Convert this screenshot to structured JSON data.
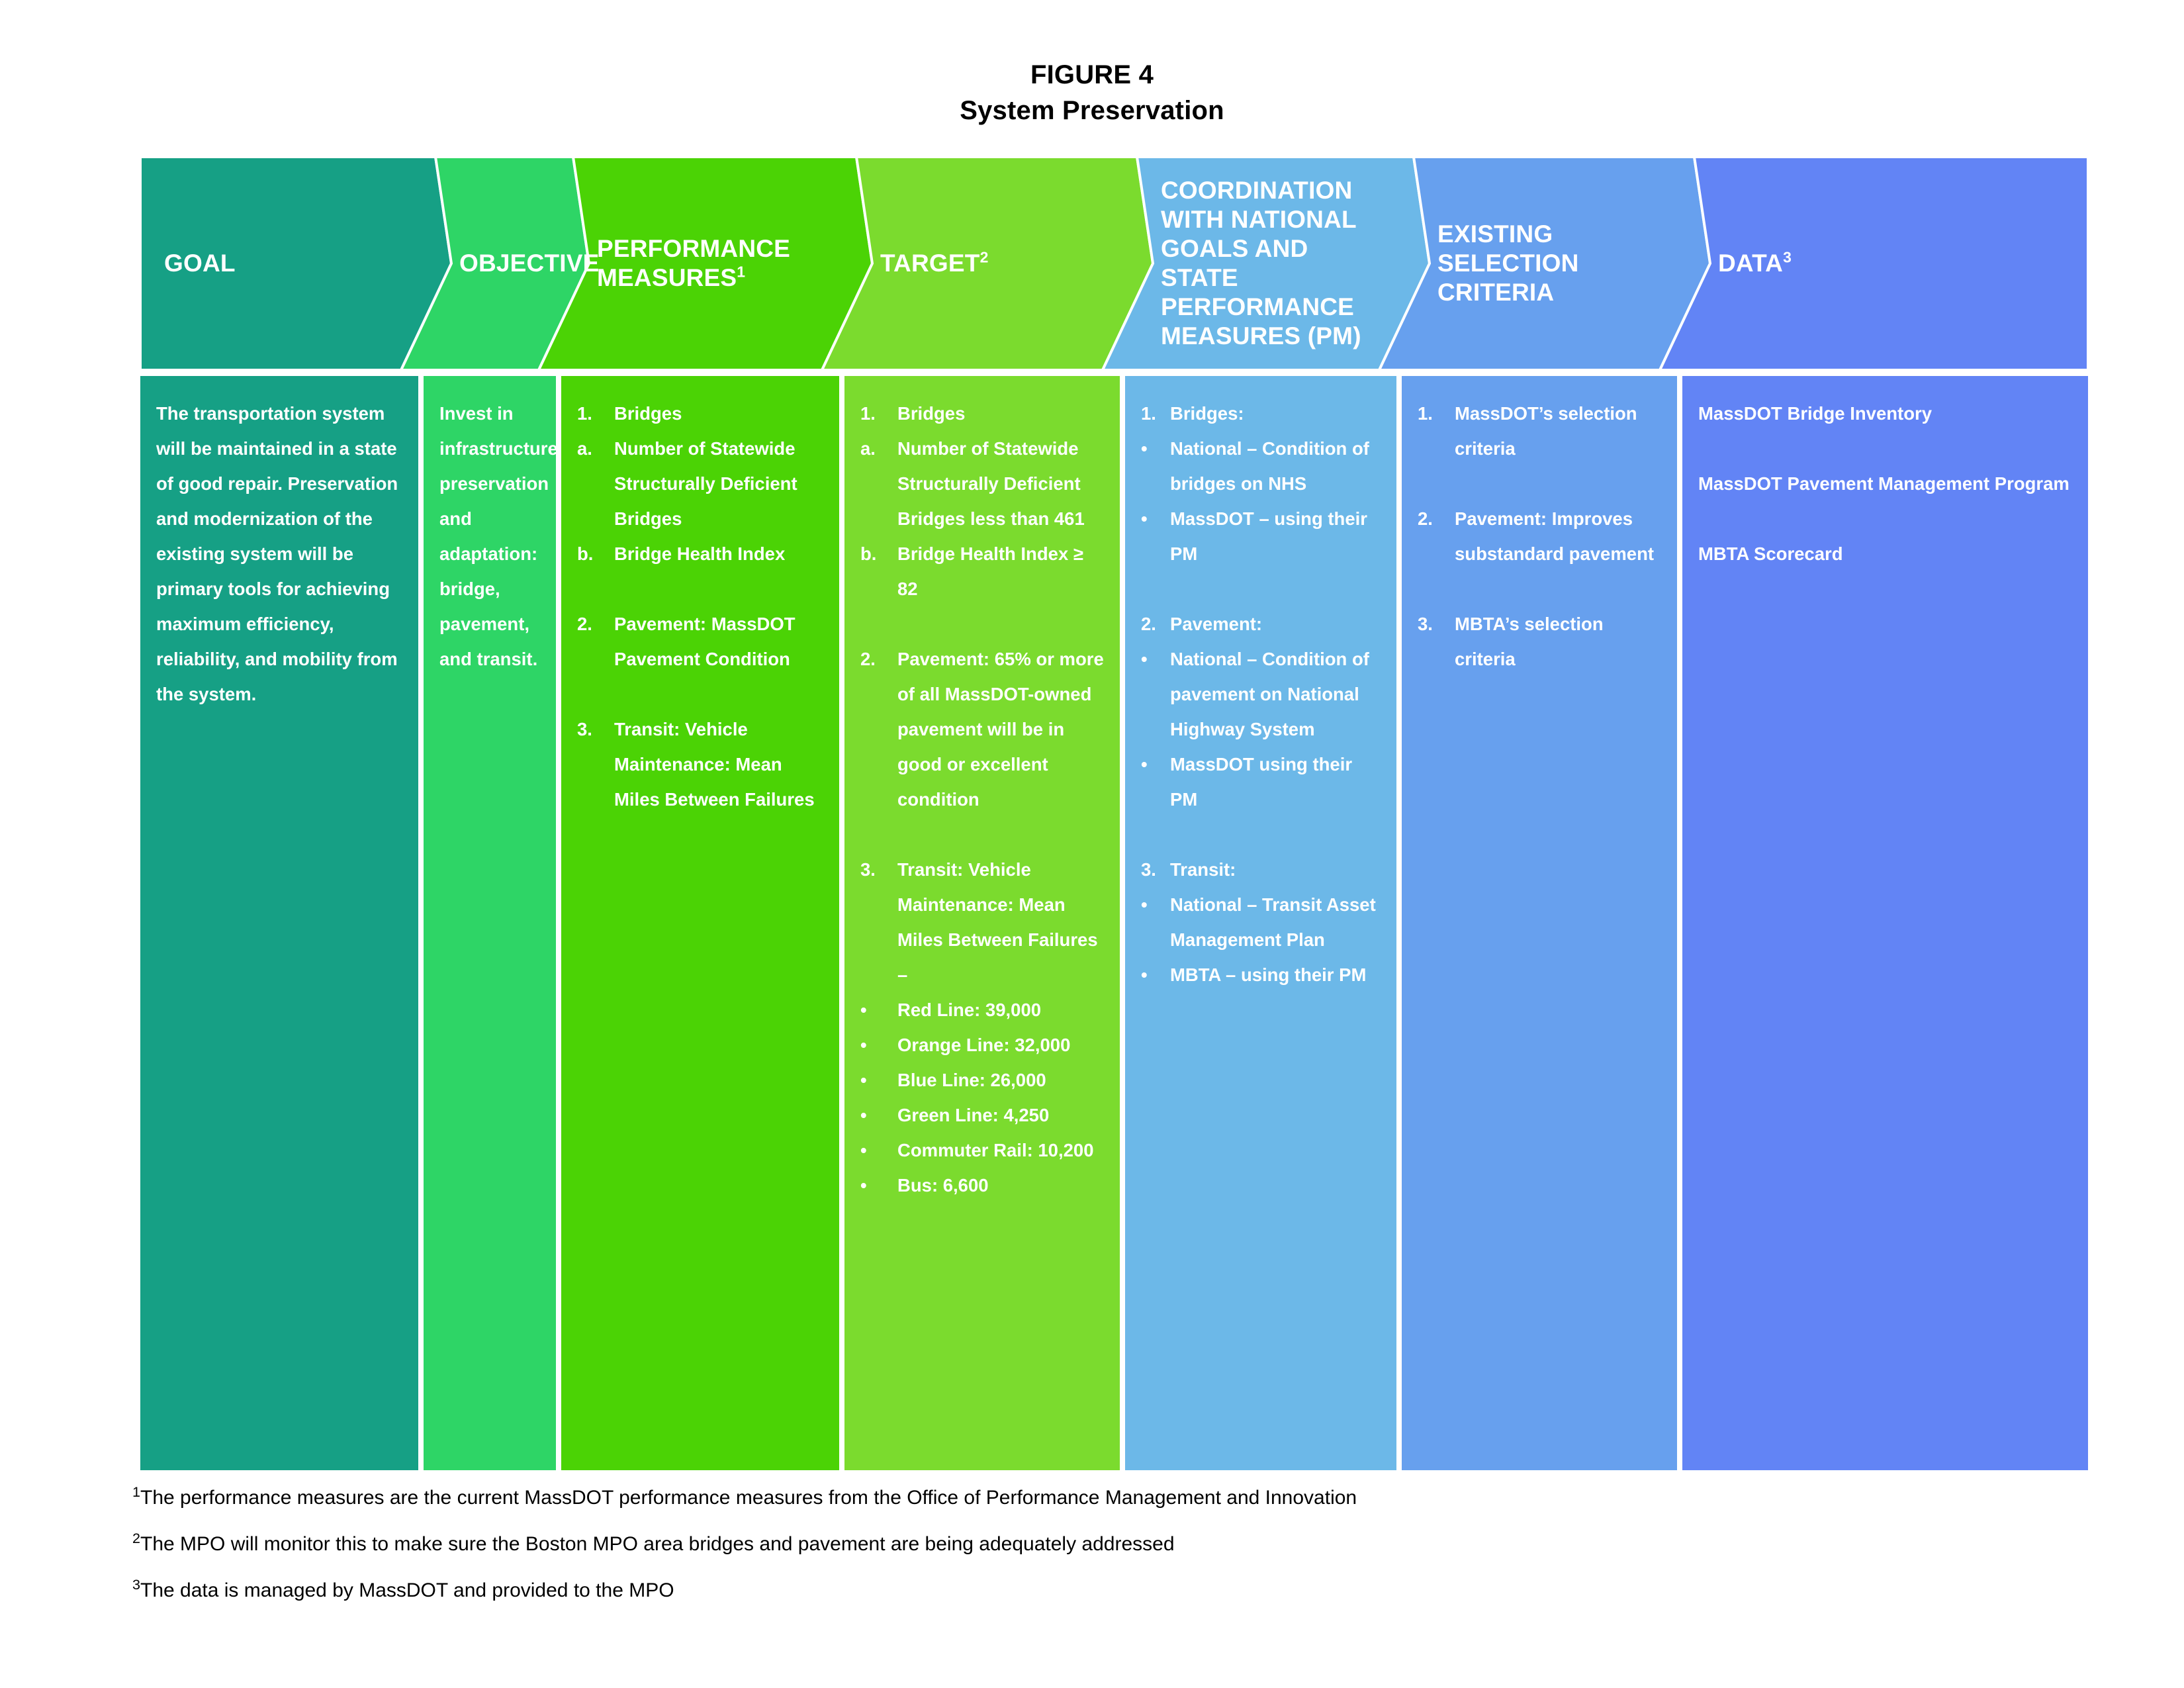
{
  "title": {
    "line1": "FIGURE 4",
    "line2": "System Preservation"
  },
  "colors": {
    "goal": "#16a085",
    "objective": "#2ed566",
    "performance_measures": "#4bd305",
    "target": "#7bdb2e",
    "coordination": "#6cb8e8",
    "existing_selection_criteria": "#67a0ee",
    "data": "#6284f5",
    "text_on_band": "#ffffff",
    "title_text": "#000000",
    "divider": "#ffffff"
  },
  "header": {
    "columns": [
      {
        "label": "GOAL",
        "sup": ""
      },
      {
        "label": "OBJECTIVE",
        "sup": ""
      },
      {
        "label": "PERFORMANCE MEASURES",
        "sup": "1"
      },
      {
        "label": "TARGET",
        "sup": "2"
      },
      {
        "label": "COORDINATION WITH NATIONAL GOALS AND STATE PERFORMANCE MEASURES (PM)",
        "sup": ""
      },
      {
        "label": "EXISTING SELECTION CRITERIA",
        "sup": ""
      },
      {
        "label": "DATA",
        "sup": "3"
      }
    ]
  },
  "body": {
    "goal": {
      "paragraph": "The transportation system will be maintained in a state of good repair. Preservation and modernization of the existing system will be primary tools for achieving maximum efficiency, reliability, and mobility from the system."
    },
    "objective": {
      "paragraph": "Invest in infrastructure preservation and adaptation: bridge, pavement, and transit."
    },
    "performance_measures": {
      "items": [
        {
          "mark": "1.",
          "text": "Bridges"
        },
        {
          "mark": "a.",
          "text": "Number of Statewide Structurally Deficient Bridges"
        },
        {
          "mark": "b.",
          "text": "Bridge Health Index"
        },
        {
          "mark": "2.",
          "text": "Pavement: MassDOT Pavement Condition"
        },
        {
          "mark": "3.",
          "text": "Transit: Vehicle Maintenance: Mean Miles Between Failures"
        }
      ]
    },
    "target": {
      "items": [
        {
          "mark": "1.",
          "text": "Bridges"
        },
        {
          "mark": "a.",
          "text": "Number of Statewide Structurally Deficient Bridges less than 461"
        },
        {
          "mark": "b.",
          "text": "Bridge Health Index ≥ 82"
        },
        {
          "mark": "2.",
          "text": "Pavement: 65% or more of all MassDOT-owned pavement will be in good or excellent condition"
        },
        {
          "mark": "3.",
          "text": "Transit: Vehicle Maintenance: Mean Miles Between Failures –"
        },
        {
          "mark": "•",
          "text": "Red Line: 39,000"
        },
        {
          "mark": "•",
          "text": "Orange Line: 32,000"
        },
        {
          "mark": "•",
          "text": "Blue Line: 26,000"
        },
        {
          "mark": "•",
          "text": "Green Line: 4,250"
        },
        {
          "mark": "•",
          "text": "Commuter Rail: 10,200"
        },
        {
          "mark": "•",
          "text": "Bus: 6,600"
        }
      ]
    },
    "coordination": {
      "items": [
        {
          "mark": "1.",
          "text": "Bridges:"
        },
        {
          "mark": "•",
          "text": "National – Condition of bridges on NHS"
        },
        {
          "mark": "•",
          "text": "MassDOT – using their PM"
        },
        {
          "mark": "2.",
          "text": "Pavement:"
        },
        {
          "mark": "•",
          "text": "National – Condition of pavement on National Highway System"
        },
        {
          "mark": "•",
          "text": "MassDOT using their PM"
        },
        {
          "mark": "3.",
          "text": "Transit:"
        },
        {
          "mark": "•",
          "text": "National – Transit Asset Management Plan"
        },
        {
          "mark": "•",
          "text": "MBTA – using their PM"
        }
      ]
    },
    "existing_selection_criteria": {
      "items": [
        {
          "mark": "1.",
          "text": "MassDOT’s selection criteria"
        },
        {
          "mark": "2.",
          "text": "Pavement: Improves substandard pavement"
        },
        {
          "mark": "3.",
          "text": "MBTA’s selection criteria"
        }
      ]
    },
    "data": {
      "items": [
        "MassDOT Bridge Inventory",
        "MassDOT Pavement Management Program",
        "MBTA Scorecard"
      ]
    }
  },
  "footnotes": [
    {
      "marker": "1",
      "text": "The performance measures are the current MassDOT performance measures from the Office of Performance Management and Innovation"
    },
    {
      "marker": "2",
      "text": "The MPO will monitor this to make sure the Boston MPO area bridges and pavement are being adequately addressed"
    },
    {
      "marker": "3",
      "text": "The data is managed by MassDOT and provided to the MPO"
    }
  ]
}
